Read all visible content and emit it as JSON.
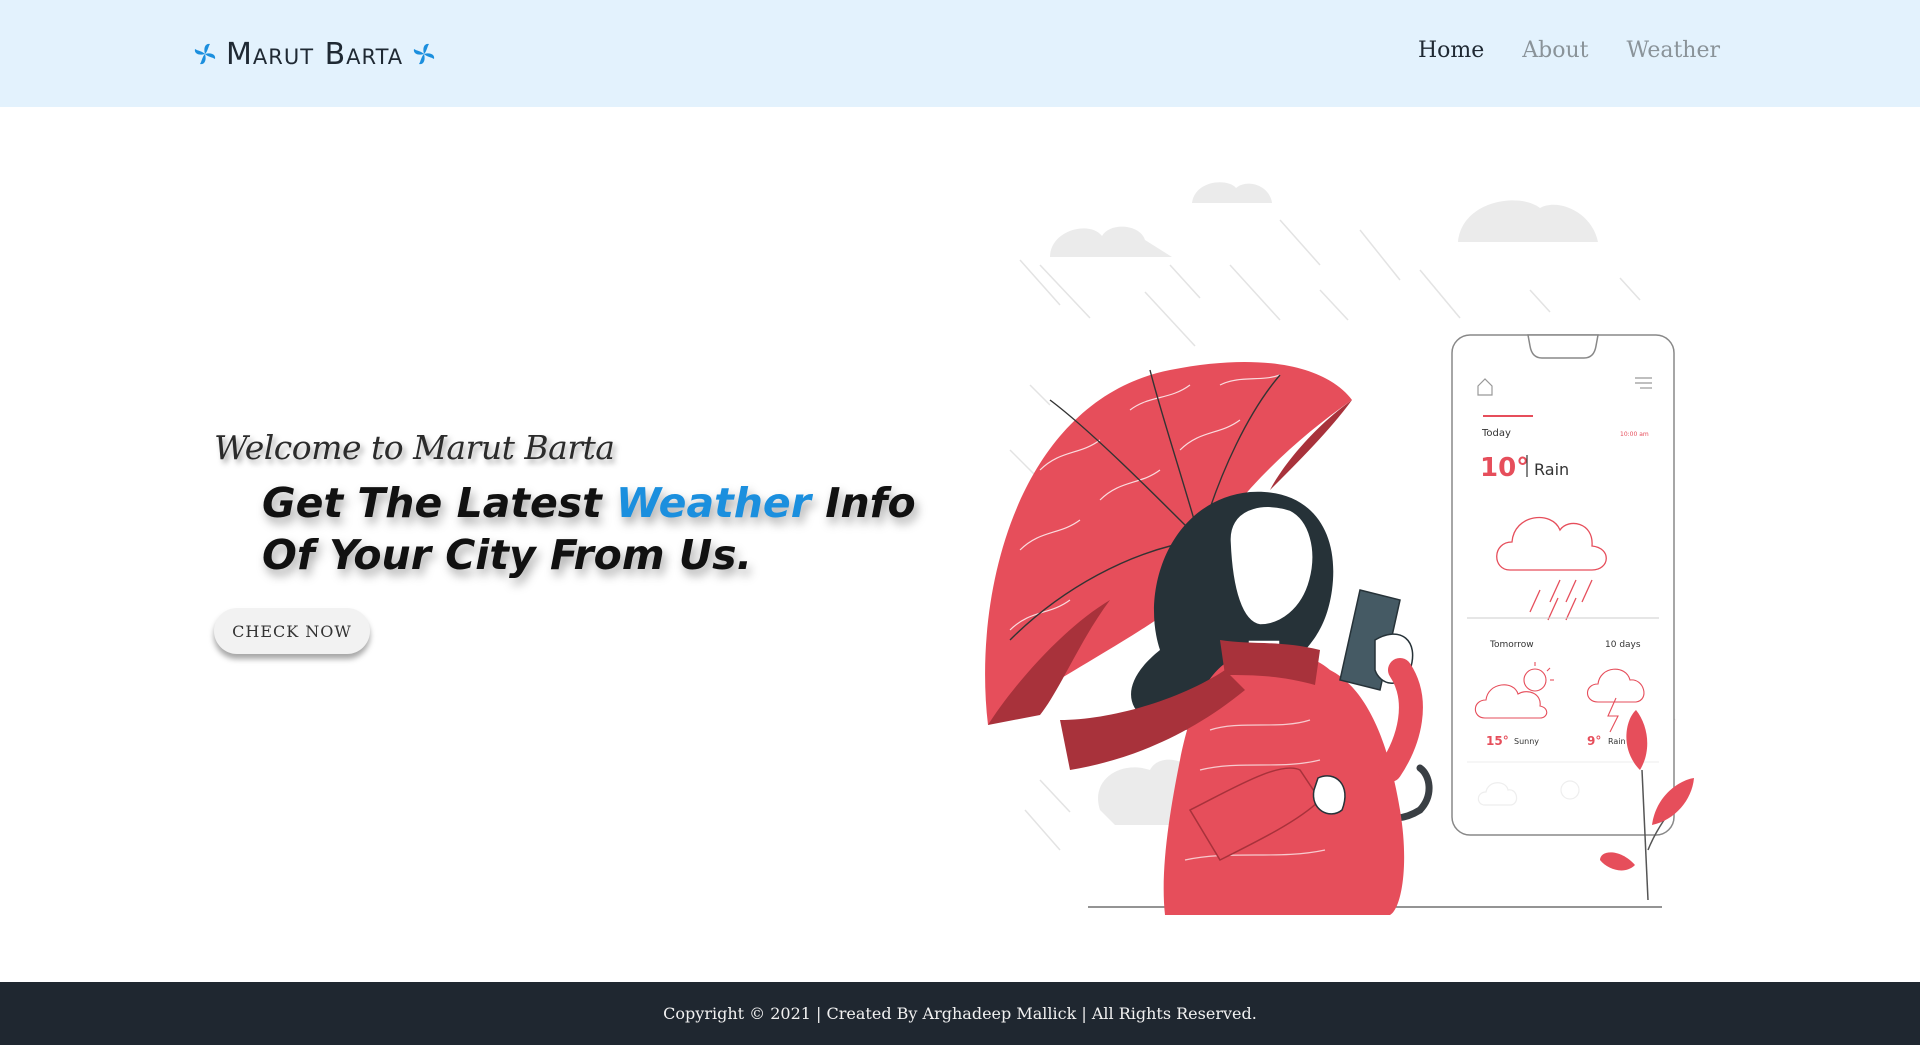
{
  "brand": {
    "name": "Marut Barta",
    "icon": "fan-icon",
    "icon_color": "#1b8fde"
  },
  "nav": {
    "items": [
      {
        "label": "Home",
        "active": true
      },
      {
        "label": "About",
        "active": false
      },
      {
        "label": "Weather",
        "active": false
      }
    ]
  },
  "hero": {
    "welcome": "Welcome to Marut Barta",
    "headline_part1": "Get The Latest ",
    "headline_highlight": "Weather",
    "headline_part2": " Info",
    "headline_line2": "Of Your City From Us.",
    "cta_label": "CHECK NOW",
    "highlight_color": "#1b8fde"
  },
  "phone": {
    "today_label": "Today",
    "time": "10:00 am",
    "today_temp": "10°",
    "today_cond": "Rain",
    "tomorrow_label": "Tomorrow",
    "ten_days_label": "10 days",
    "tomorrow_temp": "15°",
    "tomorrow_cond": "Sunny",
    "ten_temp": "9°",
    "ten_cond": "Rain"
  },
  "footer": {
    "text": "Copyright © 2021 | Created By Arghadeep Mallick | All Rights Reserved."
  }
}
